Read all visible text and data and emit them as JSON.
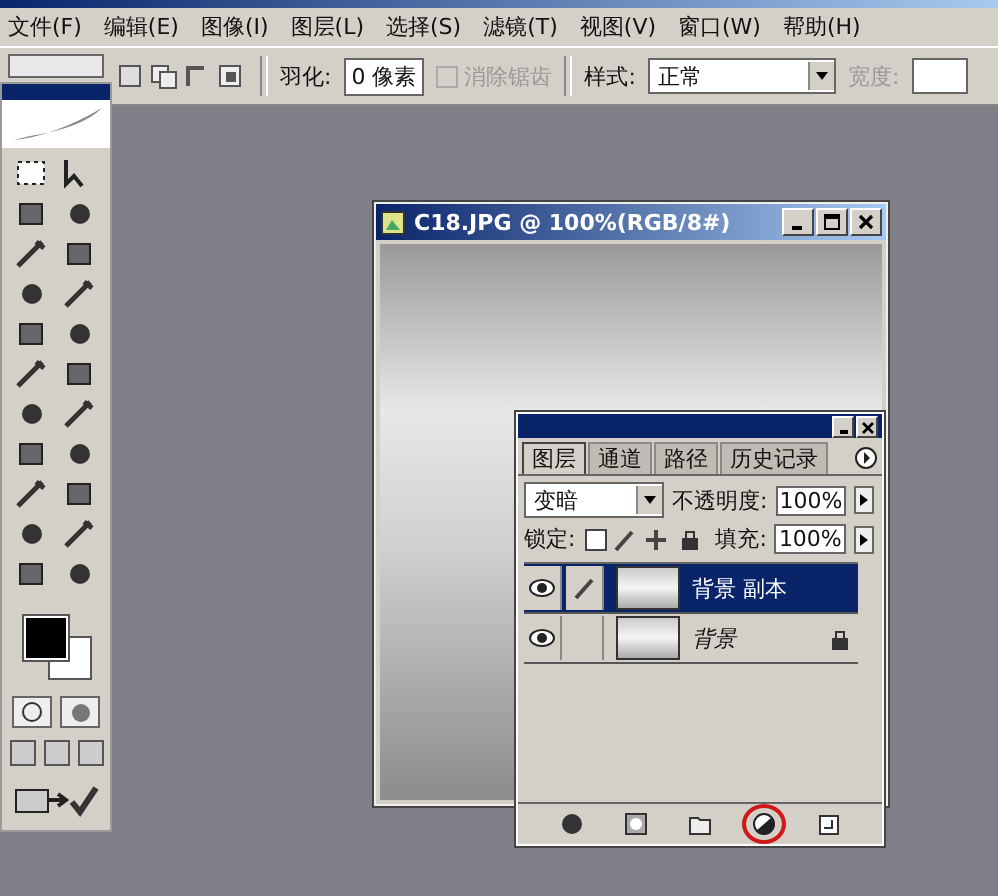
{
  "menu": [
    "文件(F)",
    "编辑(E)",
    "图像(I)",
    "图层(L)",
    "选择(S)",
    "滤镜(T)",
    "视图(V)",
    "窗口(W)",
    "帮助(H)"
  ],
  "options": {
    "feather_label": "羽化:",
    "feather_value": "0 像素",
    "antialias": {
      "label": "消除锯齿",
      "checked": false,
      "disabled": true
    },
    "style_label": "样式:",
    "style_value": "正常",
    "width_label": "宽度:"
  },
  "document": {
    "title": "C18.JPG @ 100%(RGB/8#)"
  },
  "layers_panel": {
    "tabs": [
      {
        "label": "图层",
        "selected": true
      },
      {
        "label": "通道",
        "selected": false
      },
      {
        "label": "路径",
        "selected": false
      },
      {
        "label": "历史记录",
        "selected": false
      }
    ],
    "blend_mode": "变暗",
    "opacity_label": "不透明度:",
    "opacity": "100%",
    "lock_label": "锁定:",
    "fill_label": "填充:",
    "fill": "100%",
    "layers": [
      {
        "name": "背景 副本",
        "selected": true,
        "visible": true,
        "locked": false
      },
      {
        "name": "背景",
        "selected": false,
        "visible": true,
        "locked": true
      }
    ],
    "footer_buttons": [
      {
        "kind": "style",
        "highlighted": false
      },
      {
        "kind": "mask",
        "highlighted": false
      },
      {
        "kind": "folder",
        "highlighted": false
      },
      {
        "kind": "adjustment",
        "highlighted": true
      },
      {
        "kind": "new",
        "highlighted": false
      }
    ]
  }
}
